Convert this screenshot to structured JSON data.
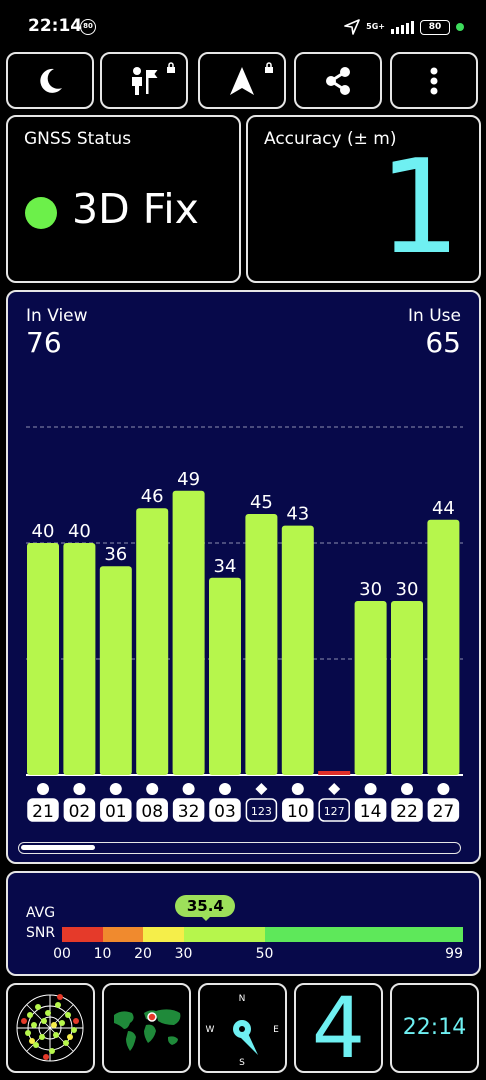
{
  "status_bar": {
    "time": "22:14",
    "notification_badge": "80",
    "network": "5G+",
    "battery": "80",
    "icons": [
      "location-arrow-icon",
      "signal-bars-icon",
      "battery-icon",
      "privacy-dot-icon"
    ]
  },
  "toolbar": {
    "buttons": [
      {
        "icon": "moon-icon",
        "label": "Night mode"
      },
      {
        "icon": "person-flag-icon",
        "label": "Locked feature"
      },
      {
        "icon": "navigation-arrow-icon",
        "label": "Locked feature"
      },
      {
        "icon": "share-icon",
        "label": "Share"
      },
      {
        "icon": "more-vert-icon",
        "label": "More"
      }
    ]
  },
  "gnss_status": {
    "title": "GNSS Status",
    "value": "3D Fix",
    "indicator_color": "#6cf04a"
  },
  "accuracy": {
    "title": "Accuracy (± m)",
    "value": "1"
  },
  "satellites": {
    "in_view_label": "In View",
    "in_view": "76",
    "in_use_label": "In Use",
    "in_use": "65",
    "scroll_position": 0.17
  },
  "chart_data": {
    "type": "bar",
    "title": "",
    "categories": [
      "21",
      "02",
      "01",
      "08",
      "32",
      "03",
      "123",
      "10",
      "127",
      "14",
      "22",
      "27"
    ],
    "values": [
      40,
      40,
      36,
      46,
      49,
      34,
      45,
      43,
      0,
      30,
      30,
      44
    ],
    "markers": [
      "circle",
      "circle",
      "circle",
      "circle",
      "circle",
      "circle",
      "diamond",
      "circle",
      "diamond",
      "circle",
      "circle",
      "circle"
    ],
    "ylim": [
      0,
      70
    ],
    "bar_color": "#b6f64c",
    "zero_bar_color": "#e0302a",
    "grid": true
  },
  "avg_snr": {
    "label_line1": "AVG",
    "label_line2": "SNR",
    "value": "35.4",
    "value_numeric": 35.4,
    "scale_ticks": [
      "00",
      "10",
      "20",
      "30",
      "50",
      "99"
    ],
    "segments": [
      {
        "from": 0,
        "to": 10,
        "color": "#e53a2a"
      },
      {
        "from": 10,
        "to": 20,
        "color": "#f08a2e"
      },
      {
        "from": 20,
        "to": 30,
        "color": "#f5ee4a"
      },
      {
        "from": 30,
        "to": 50,
        "color": "#b6f64c"
      },
      {
        "from": 50,
        "to": 99,
        "color": "#5ee85a"
      }
    ]
  },
  "bottom_bar": {
    "radar": {
      "icon": "sky-radar-icon"
    },
    "map": {
      "icon": "world-map-icon"
    },
    "compass": {
      "n": "N",
      "e": "E",
      "s": "S",
      "w": "W"
    },
    "big_number": "4",
    "clock": "22:14"
  }
}
